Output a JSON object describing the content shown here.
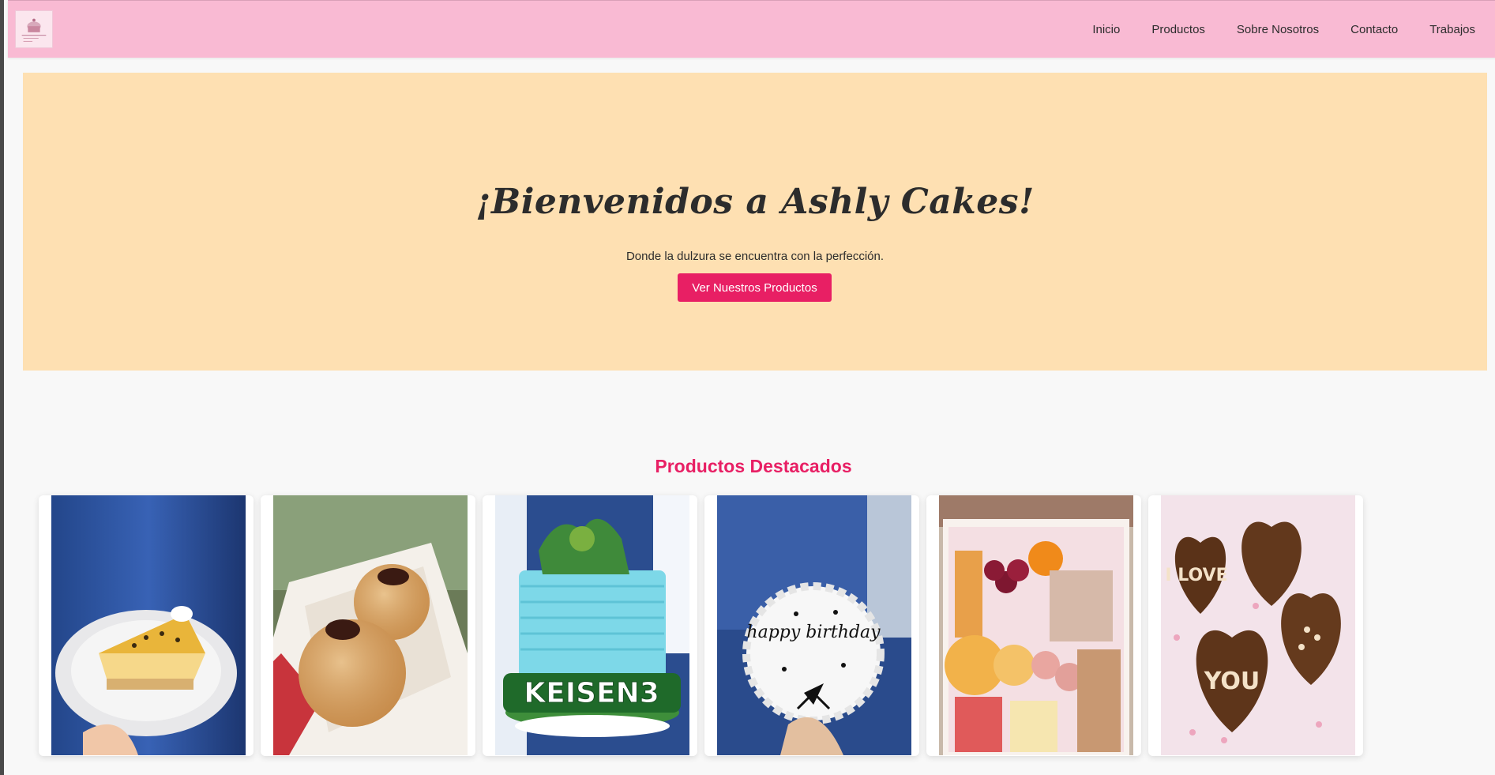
{
  "header": {
    "logo_icon": "ashly-cakes-logo",
    "nav": [
      {
        "label": "Inicio"
      },
      {
        "label": "Productos"
      },
      {
        "label": "Sobre Nosotros"
      },
      {
        "label": "Contacto"
      },
      {
        "label": "Trabajos"
      }
    ],
    "background": "#f9bad3"
  },
  "hero": {
    "title": "¡Bienvenidos a Ashly Cakes!",
    "subtitle": "Donde la dulzura se encuentra con la perfección.",
    "button_label": "Ver Nuestros Productos",
    "background": "#fee0b2",
    "button_color": "#e81f64"
  },
  "featured": {
    "title": "Productos Destacados",
    "title_color": "#e81f64",
    "products": [
      {
        "image": "passionfruit-cheesecake-photo"
      },
      {
        "image": "filled-donuts-photo"
      },
      {
        "image": "dinosaur-birthday-cake-photo",
        "cake_text": "KEISEN3"
      },
      {
        "image": "happy-birthday-cake-photo",
        "cake_text": "happy birthday"
      },
      {
        "image": "snack-box-photo"
      },
      {
        "image": "heart-brownies-photo",
        "cake_text_1": "I LOVE",
        "cake_text_2": "YOU"
      }
    ]
  }
}
